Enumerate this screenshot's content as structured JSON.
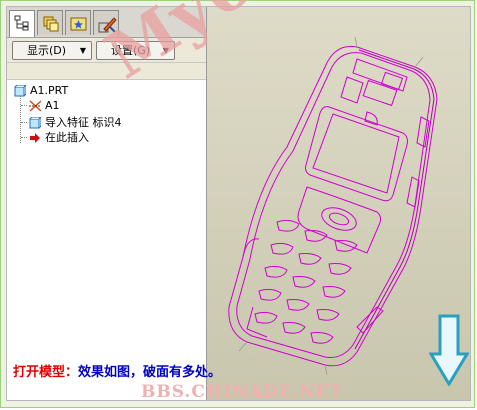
{
  "toolbar": {
    "tabs": [
      "model-tree-icon",
      "layers-icon",
      "folder-star-icon",
      "tools-icon"
    ],
    "display_label": "显示(D)",
    "settings_label": "设置(G)"
  },
  "tree": {
    "root": "A1.PRT",
    "items": [
      {
        "label": "A1",
        "icon": "coordinate-system-icon"
      },
      {
        "label": "导入特征 标识4",
        "icon": "import-feature-icon"
      },
      {
        "label": "在此插入",
        "icon": "insert-here-arrow-icon"
      }
    ]
  },
  "watermark": "My6-6",
  "caption": {
    "prefix": "打开模型：",
    "text": "效果如图，破面有多处。"
  },
  "site": "BBS.CHINADE.NET",
  "colors": {
    "model_lines": "#d000d0",
    "caption_red": "#e00000",
    "caption_blue": "#0000c0",
    "arrow": "#2aa0c0"
  }
}
